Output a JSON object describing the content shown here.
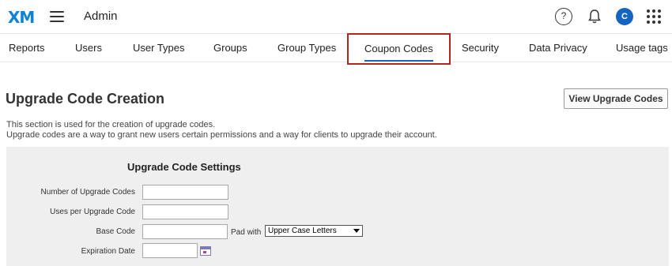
{
  "header": {
    "logo": "XM",
    "title": "Admin",
    "help_glyph": "?",
    "avatar_initial": "C",
    "icons": [
      "menu-icon",
      "help-icon",
      "bell-icon",
      "apps-grid-icon"
    ]
  },
  "tabs": [
    {
      "label": "Reports"
    },
    {
      "label": "Users"
    },
    {
      "label": "User Types"
    },
    {
      "label": "Groups"
    },
    {
      "label": "Group Types"
    },
    {
      "label": "Coupon Codes",
      "active": true
    },
    {
      "label": "Security"
    },
    {
      "label": "Data Privacy"
    },
    {
      "label": "Usage tags"
    }
  ],
  "page": {
    "title": "Upgrade Code Creation",
    "view_button": "View Upgrade Codes",
    "description": [
      "This section is used for the creation of upgrade codes.",
      "Upgrade codes are a way to grant new users certain permissions and a way for clients to upgrade their account."
    ]
  },
  "settings": {
    "title": "Upgrade Code Settings",
    "number_label": "Number of Upgrade Codes",
    "number_value": "",
    "uses_label": "Uses per Upgrade Code",
    "uses_value": "",
    "base_label": "Base Code",
    "base_value": "",
    "pad_label": "Pad with",
    "pad_selected": "Upper Case Letters",
    "expiration_label": "Expiration Date",
    "expiration_value": ""
  },
  "colors": {
    "brand_blue": "#1565c0",
    "active_tab_outline": "#b3261e",
    "panel_bg": "#efefef"
  }
}
